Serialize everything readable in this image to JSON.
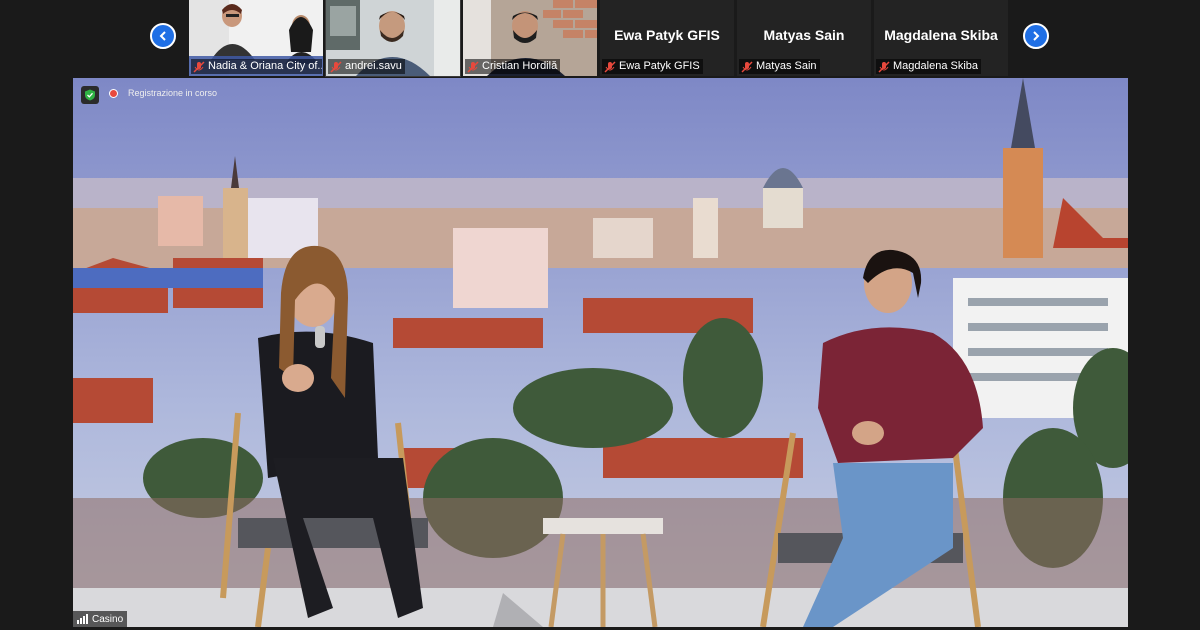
{
  "strip": {
    "prev_icon": "chevron-left-icon",
    "next_icon": "chevron-right-icon",
    "participants": [
      {
        "label": "Nadia & Oriana City of...",
        "muted": true
      },
      {
        "label": "andrei.savu",
        "muted": true
      },
      {
        "label": "Cristian Hordilă",
        "muted": true
      },
      {
        "label": "Ewa Patyk GFIS",
        "display_name": "Ewa Patyk GFIS",
        "muted": true
      },
      {
        "label": "Matyas Sain",
        "display_name": "Matyas Sain",
        "muted": true
      },
      {
        "label": "Magdalena Skiba",
        "display_name": "Magdalena Skiba",
        "muted": true
      }
    ]
  },
  "main": {
    "recording_label": "Registrazione in corso",
    "speaker_label": "Casino"
  },
  "colors": {
    "nav_button": "#1f6fe5",
    "mic_muted": "#e8493d",
    "security_shield": "#2fb344"
  }
}
